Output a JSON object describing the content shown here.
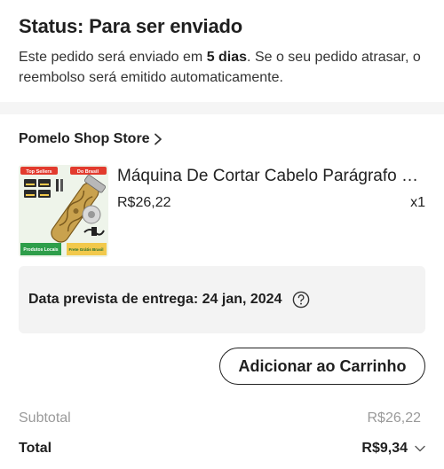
{
  "status": {
    "title": "Status: Para ser enviado",
    "desc_before": "Este pedido será enviado em ",
    "desc_bold": "5 dias",
    "desc_after": ". Se o seu pedido atrasar, o reembolso será emitido automaticamente."
  },
  "store": {
    "name": "Pomelo Shop Store",
    "icon": "chevron-right-icon"
  },
  "product": {
    "title": "Máquina De Cortar Cabelo Parágrafo Profissional Elétrica Sem Fio",
    "price": "R$26,22",
    "quantity": "x1",
    "thumb_badges": {
      "top_left": "Top Sellers",
      "top_right": "Do Brasil",
      "bottom_left": "Produtos Locais",
      "bottom_right": "Frete Grátis Brasil"
    }
  },
  "delivery": {
    "text": "Data prevista de entrega: 24 jan, 2024",
    "icon": "help-circle-icon"
  },
  "cart_button": {
    "label": "Adicionar ao Carrinho"
  },
  "summary": {
    "subtotal_label": "Subtotal",
    "subtotal_value": "R$26,22",
    "total_label": "Total",
    "total_value": "R$9,34",
    "total_icon": "chevron-down-icon"
  },
  "colors": {
    "page_bg": "#f5f5f5",
    "card_bg": "#ffffff",
    "text_primary": "#1f1f1f",
    "text_muted": "#9a9a9a",
    "delivery_bg": "#f3f3f3"
  }
}
